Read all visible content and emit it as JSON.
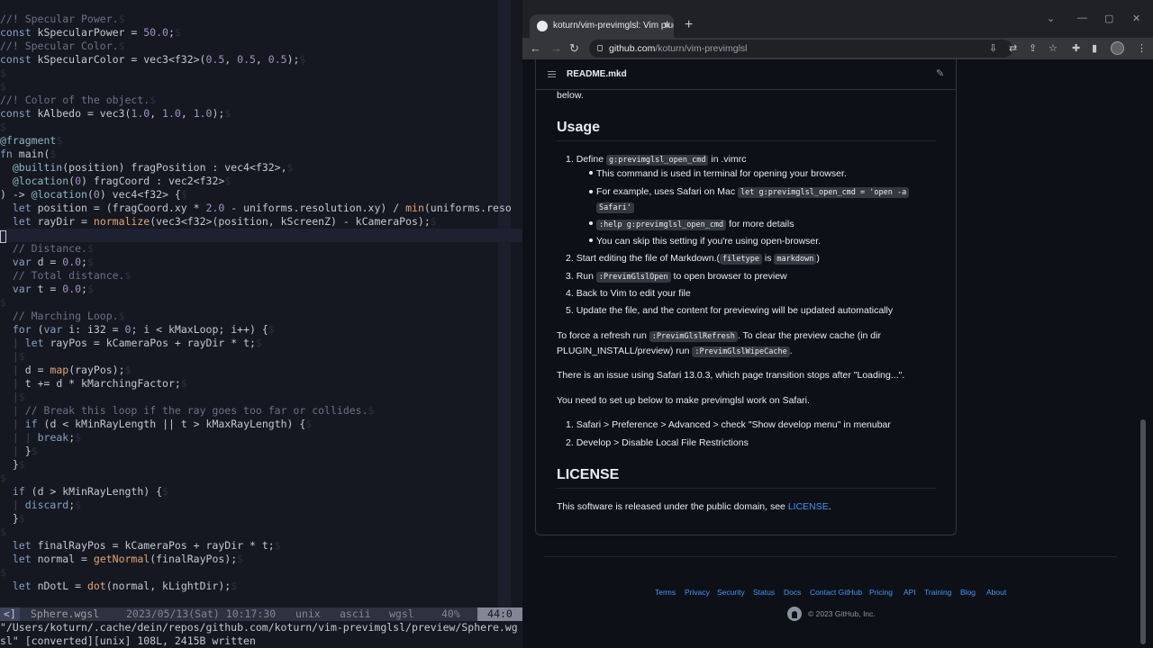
{
  "vim": {
    "lines": [
      [
        [
          "//! Specular Power.",
          "cmt"
        ],
        [
          "$",
          "eol"
        ]
      ],
      [
        [
          "const",
          "kw"
        ],
        [
          " kSpecularPower = ",
          ""
        ],
        [
          "50.0",
          "num"
        ],
        [
          ";",
          ""
        ],
        [
          "$",
          "eol"
        ]
      ],
      [
        [
          "//! Specular Color.",
          "cmt"
        ],
        [
          "$",
          "eol"
        ]
      ],
      [
        [
          "const",
          "kw"
        ],
        [
          " kSpecularColor = vec3<f32>(",
          ""
        ],
        [
          "0.5",
          "num"
        ],
        [
          ", ",
          ""
        ],
        [
          "0.5",
          "num"
        ],
        [
          ", ",
          ""
        ],
        [
          "0.5",
          "num"
        ],
        [
          ");",
          ""
        ],
        [
          "$",
          "eol"
        ]
      ],
      [
        [
          "$",
          "eol"
        ]
      ],
      [
        [
          "$",
          "eol"
        ]
      ],
      [
        [
          "//! Color of the object.",
          "cmt"
        ],
        [
          "$",
          "eol"
        ]
      ],
      [
        [
          "const",
          "kw"
        ],
        [
          " kAlbedo = vec3(",
          ""
        ],
        [
          "1.0",
          "num"
        ],
        [
          ", ",
          ""
        ],
        [
          "1.0",
          "num"
        ],
        [
          ", ",
          ""
        ],
        [
          "1.0",
          "num"
        ],
        [
          ");",
          ""
        ],
        [
          "$",
          "eol"
        ]
      ],
      [
        [
          "$",
          "eol"
        ]
      ],
      [
        [
          "@fragment",
          "attr"
        ],
        [
          "$",
          "eol"
        ]
      ],
      [
        [
          "fn",
          "kw"
        ],
        [
          " main(",
          ""
        ],
        [
          "$",
          "eol"
        ]
      ],
      [
        [
          "  @builtin",
          "attr"
        ],
        [
          "(position) fragPosition : vec4<f32>,",
          ""
        ],
        [
          "$",
          "eol"
        ]
      ],
      [
        [
          "  @location",
          "attr"
        ],
        [
          "(",
          ""
        ],
        [
          "0",
          "num"
        ],
        [
          ") fragCoord : vec2<f32>",
          ""
        ],
        [
          "$",
          "eol"
        ]
      ],
      [
        [
          ") -> ",
          ""
        ],
        [
          "@location",
          "attr"
        ],
        [
          "(",
          ""
        ],
        [
          "0",
          "num"
        ],
        [
          ") vec4<f32> {",
          ""
        ],
        [
          "$",
          "eol"
        ]
      ],
      [
        [
          "  ",
          ""
        ],
        [
          "let",
          "kw"
        ],
        [
          " position = (fragCoord.xy * ",
          ""
        ],
        [
          "2.0",
          "num"
        ],
        [
          " - uniforms.resolution.xy) / ",
          ""
        ],
        [
          "min",
          "fn"
        ],
        [
          "(uniforms.reso",
          ""
        ]
      ],
      [
        [
          "  ",
          ""
        ],
        [
          "let",
          "kw"
        ],
        [
          " rayDir = ",
          ""
        ],
        [
          "normalize",
          "fn"
        ],
        [
          "(vec3<f32>(position, kScreenZ) - kCameraPos);",
          ""
        ],
        [
          "$",
          "eol"
        ]
      ],
      [
        [
          "",
          ""
        ]
      ],
      [
        [
          "  // Distance.",
          "cmt"
        ],
        [
          "$",
          "eol"
        ]
      ],
      [
        [
          "  ",
          ""
        ],
        [
          "var",
          "kw"
        ],
        [
          " d = ",
          ""
        ],
        [
          "0.0",
          "num"
        ],
        [
          ";",
          ""
        ],
        [
          "$",
          "eol"
        ]
      ],
      [
        [
          "  // Total distance.",
          "cmt"
        ],
        [
          "$",
          "eol"
        ]
      ],
      [
        [
          "  ",
          ""
        ],
        [
          "var",
          "kw"
        ],
        [
          " t = ",
          ""
        ],
        [
          "0.0",
          "num"
        ],
        [
          ";",
          ""
        ],
        [
          "$",
          "eol"
        ]
      ],
      [
        [
          "$",
          "eol"
        ]
      ],
      [
        [
          "  // Marching Loop.",
          "cmt"
        ],
        [
          "$",
          "eol"
        ]
      ],
      [
        [
          "  ",
          ""
        ],
        [
          "for",
          "kw"
        ],
        [
          " (",
          ""
        ],
        [
          "var",
          "kw"
        ],
        [
          " i: i32 = ",
          ""
        ],
        [
          "0",
          "num"
        ],
        [
          "; i < kMaxLoop; i++) {",
          ""
        ],
        [
          "$",
          "eol"
        ]
      ],
      [
        [
          "  ",
          ""
        ],
        [
          "|",
          "guide"
        ],
        [
          " ",
          ""
        ],
        [
          "let",
          "kw"
        ],
        [
          " rayPos = kCameraPos + rayDir * t;",
          ""
        ],
        [
          "$",
          "eol"
        ]
      ],
      [
        [
          "  ",
          ""
        ],
        [
          "|",
          "guide"
        ],
        [
          "$",
          "eol"
        ]
      ],
      [
        [
          "  ",
          ""
        ],
        [
          "|",
          "guide"
        ],
        [
          " d = ",
          ""
        ],
        [
          "map",
          "fn"
        ],
        [
          "(rayPos);",
          ""
        ],
        [
          "$",
          "eol"
        ]
      ],
      [
        [
          "  ",
          ""
        ],
        [
          "|",
          "guide"
        ],
        [
          " t += d * kMarchingFactor;",
          ""
        ],
        [
          "$",
          "eol"
        ]
      ],
      [
        [
          "  ",
          ""
        ],
        [
          "|",
          "guide"
        ],
        [
          "$",
          "eol"
        ]
      ],
      [
        [
          "  ",
          ""
        ],
        [
          "|",
          "guide"
        ],
        [
          " // Break this loop if the ray goes too far or collides.",
          "cmt"
        ],
        [
          "$",
          "eol"
        ]
      ],
      [
        [
          "  ",
          ""
        ],
        [
          "|",
          "guide"
        ],
        [
          " ",
          ""
        ],
        [
          "if",
          "kw"
        ],
        [
          " (d < kMinRayLength || t > kMaxRayLength) {",
          ""
        ],
        [
          "$",
          "eol"
        ]
      ],
      [
        [
          "  ",
          ""
        ],
        [
          "|",
          "guide"
        ],
        [
          " ",
          ""
        ],
        [
          "|",
          "guide"
        ],
        [
          " ",
          ""
        ],
        [
          "break",
          "kw"
        ],
        [
          ";",
          ""
        ],
        [
          "$",
          "eol"
        ]
      ],
      [
        [
          "  ",
          ""
        ],
        [
          "|",
          "guide"
        ],
        [
          " }",
          ""
        ],
        [
          "$",
          "eol"
        ]
      ],
      [
        [
          "  }",
          ""
        ],
        [
          "$",
          "eol"
        ]
      ],
      [
        [
          "$",
          "eol"
        ]
      ],
      [
        [
          "  ",
          ""
        ],
        [
          "if",
          "kw"
        ],
        [
          " (d > kMinRayLength) {",
          ""
        ],
        [
          "$",
          "eol"
        ]
      ],
      [
        [
          "  ",
          ""
        ],
        [
          "|",
          "guide"
        ],
        [
          " ",
          ""
        ],
        [
          "discard",
          "kw"
        ],
        [
          ";",
          ""
        ],
        [
          "$",
          "eol"
        ]
      ],
      [
        [
          "  }",
          ""
        ],
        [
          "$",
          "eol"
        ]
      ],
      [
        [
          "$",
          "eol"
        ]
      ],
      [
        [
          "  ",
          ""
        ],
        [
          "let",
          "kw"
        ],
        [
          " finalRayPos = kCameraPos + rayDir * t;",
          ""
        ],
        [
          "$",
          "eol"
        ]
      ],
      [
        [
          "  ",
          ""
        ],
        [
          "let",
          "kw"
        ],
        [
          " normal = ",
          ""
        ],
        [
          "getNormal",
          "fn"
        ],
        [
          "(finalRayPos);",
          ""
        ],
        [
          "$",
          "eol"
        ]
      ],
      [
        [
          "$",
          "eol"
        ]
      ],
      [
        [
          "  ",
          ""
        ],
        [
          "let",
          "kw"
        ],
        [
          " nDotL = ",
          ""
        ],
        [
          "dot",
          "fn"
        ],
        [
          "(normal, kLightDir);",
          ""
        ],
        [
          "$",
          "eol"
        ]
      ]
    ],
    "cursor_line": 16,
    "status": {
      "mode": "<]",
      "file": "Sphere.wgsl",
      "datetime": "2023/05/13(Sat) 10:17:30",
      "fileformat": "unix",
      "encoding": "ascii",
      "filetype": "wgsl",
      "percent": "40%",
      "position": "44:0"
    },
    "cmdline": [
      "\"/Users/koturn/.cache/dein/repos/github.com/koturn/vim-previmglsl/preview/Sphere.wg",
      "sl\" [converted][unix] 108L, 2415B written"
    ]
  },
  "browser": {
    "tab_title": "koturn/vim-previmglsl: Vim plugin",
    "url_host": "github.com",
    "url_path": "/koturn/vim-previmglsl",
    "readme": {
      "title": "README.mkd",
      "intro_tail": "below.",
      "usage_heading": "Usage",
      "step1_pre": "Define ",
      "step1_code": "g:previmglsl_open_cmd",
      "step1_post": " in .vimrc",
      "sub1": "This command is used in terminal for opening your browser.",
      "sub2_pre": "For example, uses Safari on Mac ",
      "sub2_code": "let g:previmglsl_open_cmd = 'open -a",
      "sub2_code2": "Safari'",
      "sub3_code": ":help g:previmglsl_open_cmd",
      "sub3_post": " for more details",
      "sub4": "You can skip this setting if you're using open-browser.",
      "step2_pre": "Start editing the file of Markdown.(",
      "step2_code1": "filetype",
      "step2_mid": " is ",
      "step2_code2": "markdown",
      "step2_post": ")",
      "step3_pre": "Run ",
      "step3_code": ":PrevimGlslOpen",
      "step3_post": " to open browser to preview",
      "step4": "Back to Vim to edit your file",
      "step5": "Update the file, and the content for previewing will be updated automatically",
      "refresh_pre": "To force a refresh run ",
      "refresh_code": ":PrevimGlslRefresh",
      "refresh_post": ". To clear the preview cache (in dir",
      "refresh2_pre": "PLUGIN_INSTALL/preview) run ",
      "refresh2_code": ":PrevimGlslWipeCache",
      "refresh2_post": ".",
      "safari_issue": "There is an issue using Safari 13.0.3, which page transition stops after \"Loading...\".",
      "safari_setup": "You need to set up below to make previmglsl work on Safari.",
      "safari_step1": "Safari > Preference > Advanced > check \"Show develop menu\" in menubar",
      "safari_step2": "Develop > Disable Local File Restrictions",
      "license_heading": "LICENSE",
      "license_pre": "This software is released under the public domain, see ",
      "license_link": "LICENSE",
      "license_post": "."
    },
    "footer": {
      "links": [
        "Terms",
        "Privacy",
        "Security",
        "Status",
        "Docs",
        "Contact GitHub",
        "Pricing",
        "API",
        "Training",
        "Blog",
        "About"
      ],
      "copyright": "© 2023 GitHub, Inc."
    }
  }
}
